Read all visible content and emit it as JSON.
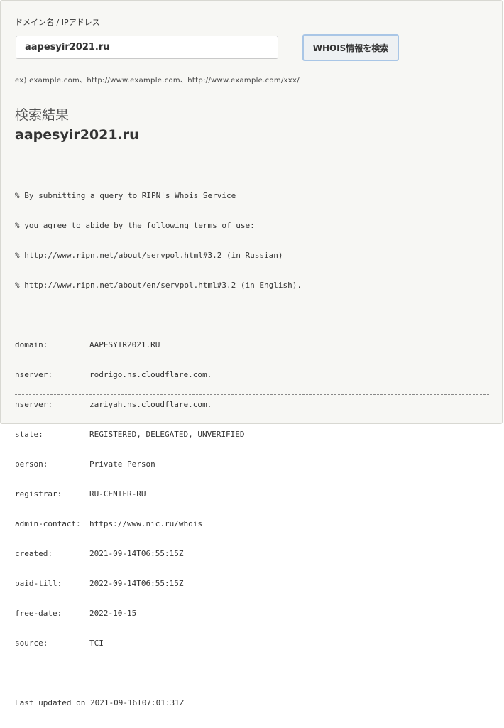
{
  "search": {
    "label": "ドメイン名 / IPアドレス",
    "input_value": "aapesyir2021.ru",
    "button_label": "WHOIS情報を検索",
    "example_text": "ex)  example.com、http://www.example.com、http://www.example.com/xxx/"
  },
  "result": {
    "heading": "検索結果",
    "domain": "aapesyir2021.ru",
    "notice_lines": [
      "% By submitting a query to RIPN's Whois Service",
      "% you agree to abide by the following terms of use:",
      "% http://www.ripn.net/about/servpol.html#3.2 (in Russian)",
      "% http://www.ripn.net/about/en/servpol.html#3.2 (in English)."
    ],
    "records": [
      {
        "key": "domain:",
        "value": "AAPESYIR2021.RU"
      },
      {
        "key": "nserver:",
        "value": "rodrigo.ns.cloudflare.com."
      },
      {
        "key": "nserver:",
        "value": "zariyah.ns.cloudflare.com."
      },
      {
        "key": "state:",
        "value": "REGISTERED, DELEGATED, UNVERIFIED"
      },
      {
        "key": "person:",
        "value": "Private Person"
      },
      {
        "key": "registrar:",
        "value": "RU-CENTER-RU"
      },
      {
        "key": "admin-contact:",
        "value": "https://www.nic.ru/whois"
      },
      {
        "key": "created:",
        "value": "2021-09-14T06:55:15Z"
      },
      {
        "key": "paid-till:",
        "value": "2022-09-14T06:55:15Z"
      },
      {
        "key": "free-date:",
        "value": "2022-10-15"
      },
      {
        "key": "source:",
        "value": "TCI"
      }
    ],
    "last_updated": "Last updated on 2021-09-16T07:01:31Z"
  }
}
